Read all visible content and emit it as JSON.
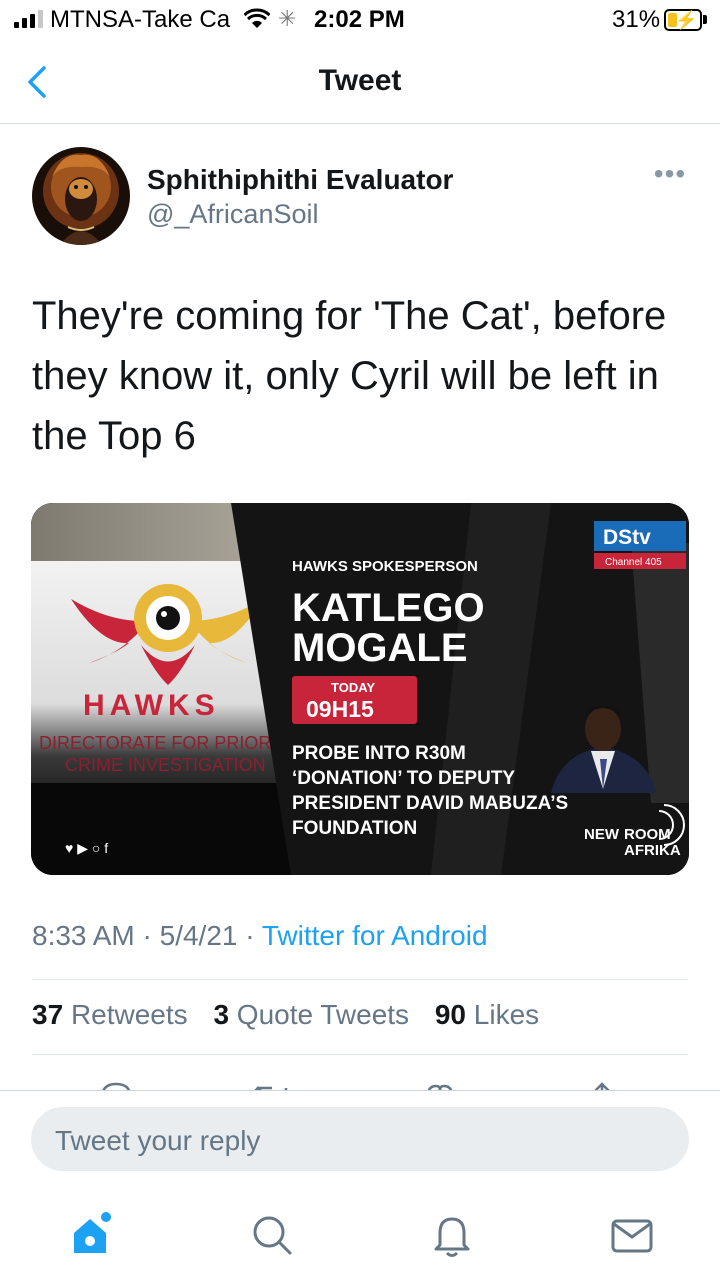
{
  "status_bar": {
    "carrier": "MTNSA-Take Ca",
    "time": "2:02 PM",
    "battery_pct": "31%",
    "battery_level": 0.31
  },
  "header": {
    "back_icon": "chevron-left-icon",
    "title": "Tweet"
  },
  "tweet": {
    "author_name": "Sphithiphithi Evaluator",
    "handle": "@_AfricanSoil",
    "text": "They're coming for 'The Cat', before they know it, only Cyril will be left in the Top 6",
    "media": {
      "hawks_word": "HAWKS",
      "hawks_line1": "DIRECTORATE FOR PRIORITY",
      "hawks_line2": "CRIME INVESTIGATION",
      "dstv": "DStv",
      "channel": "Channel 405",
      "kicker": "HAWKS SPOKESPERSON",
      "name_line1": "KATLEGO",
      "name_line2": "MOGALE",
      "today": "TODAY",
      "time": "09H15",
      "headline1": "PROBE INTO R30M",
      "headline2": "‘DONATION’ TO DEPUTY",
      "headline3": "PRESIDENT DAVID MABUZA’S",
      "headline4": "FOUNDATION",
      "newsroom1": "NEW",
      "newsroom2": "ROOM",
      "newsroom3": "AFRIKA",
      "social": "♥ ▶ ○ f"
    },
    "time": "8:33 AM",
    "date": "5/4/21",
    "source": "Twitter for Android",
    "retweets": "37",
    "retweets_label": "Retweets",
    "quotes": "3",
    "quotes_label": "Quote Tweets",
    "likes": "90",
    "likes_label": "Likes"
  },
  "reply": {
    "placeholder": "Tweet your reply"
  },
  "tabs": [
    "home-icon",
    "search-icon",
    "notifications-icon",
    "messages-icon"
  ],
  "colors": {
    "twitter_blue": "#1da1f2",
    "secondary_text": "#657786",
    "hawks_red": "#c8253a",
    "hawks_gold": "#e8b83a"
  }
}
